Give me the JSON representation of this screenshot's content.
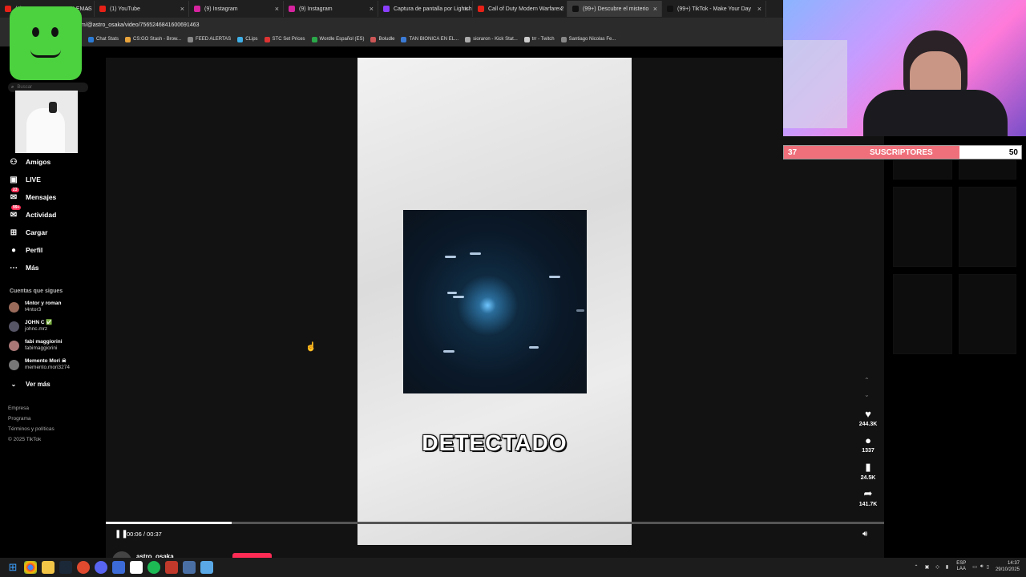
{
  "browser": {
    "tabs": [
      {
        "title": "(1) BUSCANDO PROBLEMAS E",
        "color": "#e62117"
      },
      {
        "title": "(1) YouTube",
        "color": "#e62117"
      },
      {
        "title": "(9) Instagram",
        "color": "#d6249f"
      },
      {
        "title": "(9) Instagram",
        "color": "#d6249f"
      },
      {
        "title": "Captura de pantalla por Lightsh",
        "color": "#8a3ffc"
      },
      {
        "title": "Call of Duty Modern Warfare 2",
        "color": "#e62117"
      },
      {
        "title": "(99+) Descubre el misterio",
        "color": "#111111"
      },
      {
        "title": "(99+) TikTok - Make Your Day",
        "color": "#111111"
      }
    ],
    "url": "om/@astro_osaka/video/7565246841600691463",
    "bookmarks": [
      "Chat Stats",
      "CS:GO Stash - Brow...",
      "FEED ALERTAS",
      "CLips",
      "STC Set Prices",
      "Wordle Español (ES)",
      "Boludle",
      "TAN BIONICA EN EL...",
      "sioraron - Kick Stat...",
      "trr - Twitch",
      "Santiago Nicolas Fe..."
    ]
  },
  "sidebar": {
    "search_placeholder": "Buscar",
    "nav": [
      {
        "label": "Amigos",
        "icon": "friends-icon"
      },
      {
        "label": "LIVE",
        "icon": "live-icon"
      },
      {
        "label": "Mensajes",
        "icon": "messages-icon",
        "badge": "23"
      },
      {
        "label": "Actividad",
        "icon": "activity-icon",
        "badge": "99+"
      },
      {
        "label": "Cargar",
        "icon": "upload-icon"
      },
      {
        "label": "Perfil",
        "icon": "profile-icon"
      },
      {
        "label": "Más",
        "icon": "more-icon"
      }
    ],
    "following_title": "Cuentas que sigues",
    "following": [
      {
        "name": "t4ntor y roman",
        "handle": "t4ntor3"
      },
      {
        "name": "JOHN C ✅",
        "handle": "johnc.mrz"
      },
      {
        "name": "fabi maggiorini",
        "handle": "fabimaggiorini"
      },
      {
        "name": "Memento Mori ☠",
        "handle": "memento.mori3274"
      }
    ],
    "see_more": "Ver más",
    "footer": [
      "Empresa",
      "Programa",
      "Términos y políticas",
      "© 2025 TikTok"
    ]
  },
  "video": {
    "caption": "DETECTADO",
    "time": "00:06 / 00:37",
    "progress": 0.162,
    "author": "astro_osaka",
    "actions": [
      {
        "icon": "heart-icon",
        "count": "244.3K"
      },
      {
        "icon": "comment-icon",
        "count": "1337"
      },
      {
        "icon": "bookmark-icon",
        "count": "24.5K"
      },
      {
        "icon": "share-icon",
        "count": "141.7K"
      }
    ]
  },
  "stream_overlay": {
    "subs_current": "37",
    "subs_label": "SUSCRIPTORES",
    "subs_goal": "50",
    "fill_fraction": 0.74,
    "fill_color": "#ef6f7a"
  },
  "taskbar": {
    "lang": "ESP",
    "lang2": "LAA",
    "time": "14:37",
    "date": "29/10/2025"
  }
}
